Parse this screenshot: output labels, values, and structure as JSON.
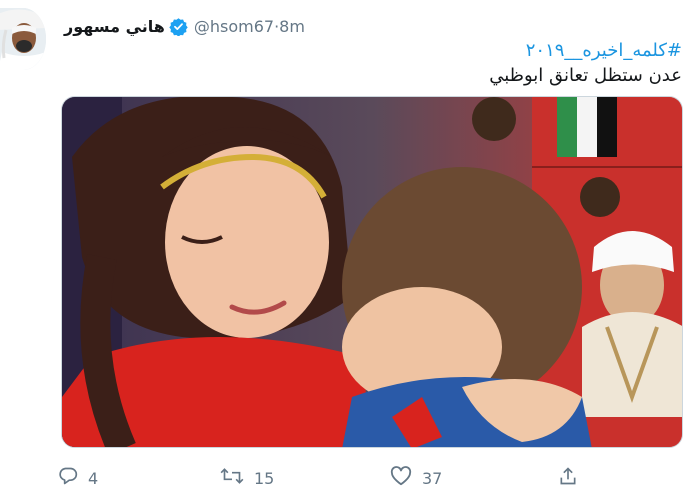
{
  "author": {
    "name": "هاني مسهور",
    "handle": "@hsom67",
    "separator": " · ",
    "time": "8m"
  },
  "tweet": {
    "hashtag": "#كلمه_اخيره__٢٠١٩",
    "text": "عدن ستظل تعانق ابوظبي"
  },
  "icons": {
    "avatar": "avatar",
    "verified": "verified-badge-icon",
    "reply": "reply-icon",
    "retweet": "retweet-icon",
    "like": "heart-icon",
    "share": "share-icon"
  },
  "stats": {
    "replies": "4",
    "retweets": "15",
    "likes": "37"
  },
  "colors": {
    "accent": "#1b95e0",
    "muted": "#657786"
  }
}
